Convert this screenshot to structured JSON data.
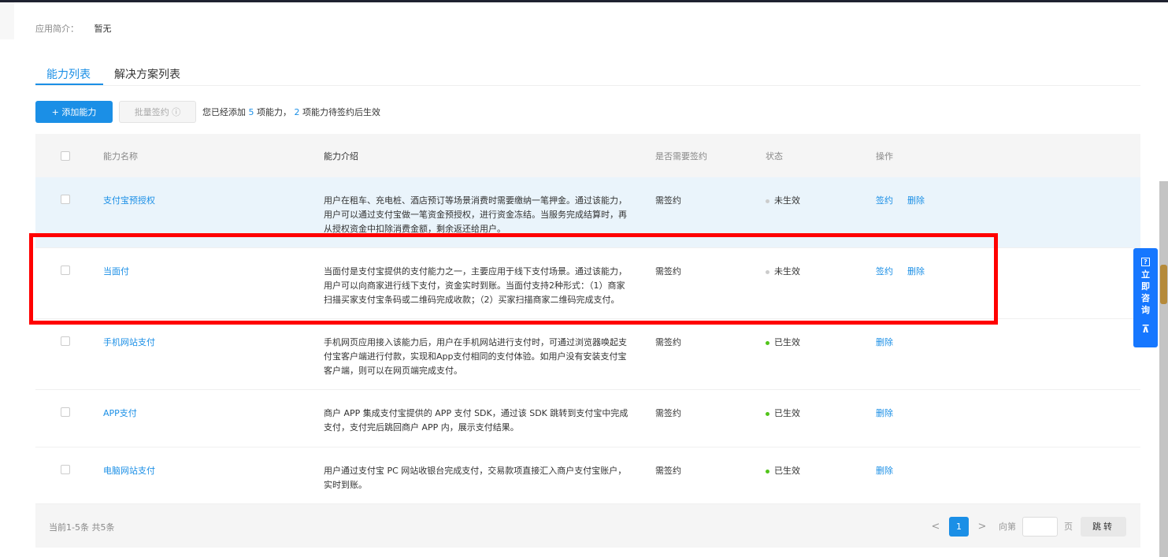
{
  "intro": {
    "label": "应用简介：",
    "value": "暂无"
  },
  "tabs": [
    {
      "label": "能力列表",
      "active": true
    },
    {
      "label": "解决方案列表",
      "active": false
    }
  ],
  "toolbar": {
    "add_label": "+  添加能力",
    "batch_label": "批量签约 ⓘ",
    "summary": {
      "p1": "您已经添加 ",
      "n1": "5",
      "p2": " 项能力， ",
      "n2": "2",
      "p3": " 项能力待签约后生效"
    }
  },
  "table": {
    "headers": {
      "name": "能力名称",
      "desc": "能力介绍",
      "sign": "是否需要签约",
      "status": "状态",
      "ops": "操作"
    },
    "rows": [
      {
        "name": "支付宝预授权",
        "desc": "用户在租车、充电桩、酒店预订等场景消费时需要缴纳一笔押金。通过该能力，用户可以通过支付宝做一笔资金预授权，进行资金冻结。当服务完成结算时，再从授权资金中扣除消费金额，剩余返还给用户。",
        "sign": "需签约",
        "status": "未生效",
        "status_color": "#cccccc",
        "ops": [
          "签约",
          "删除"
        ]
      },
      {
        "name": "当面付",
        "desc": "当面付是支付宝提供的支付能力之一，主要应用于线下支付场景。通过该能力，用户可以向商家进行线下支付，资金实时到账。当面付支持2种形式：（1）商家扫描买家支付宝条码或二维码完成收款；（2）买家扫描商家二维码完成支付。",
        "sign": "需签约",
        "status": "未生效",
        "status_color": "#cccccc",
        "ops": [
          "签约",
          "删除"
        ]
      },
      {
        "name": "手机网站支付",
        "desc": "手机网页应用接入该能力后，用户在手机网站进行支付时，可通过浏览器唤起支付宝客户端进行付款，实现和App支付相同的支付体验。如用户没有安装支付宝客户端，则可以在网页端完成支付。",
        "sign": "需签约",
        "status": "已生效",
        "status_color": "#52c41a",
        "ops": [
          "删除"
        ]
      },
      {
        "name": "APP支付",
        "desc": "商户 APP 集成支付宝提供的 APP 支付 SDK，通过该 SDK 跳转到支付宝中完成支付，支付完后跳回商户 APP 内，展示支付结果。",
        "sign": "需签约",
        "status": "已生效",
        "status_color": "#52c41a",
        "ops": [
          "删除"
        ]
      },
      {
        "name": "电脑网站支付",
        "desc": "用户通过支付宝 PC 网站收银台完成支付，交易款项直接汇入商户支付宝账户，实时到账。",
        "sign": "需签约",
        "status": "已生效",
        "status_color": "#52c41a",
        "ops": [
          "删除"
        ]
      }
    ]
  },
  "footer": {
    "total": "当前1-5条 共5条",
    "prev": "<",
    "current_page": "1",
    "next": ">",
    "goto_label": "向第",
    "page_unit": "页",
    "go_label": "跳转",
    "goto_value": ""
  },
  "float": {
    "icon": "question-icon",
    "label": [
      "立",
      "即",
      "咨",
      "询"
    ],
    "top_icon": "back-to-top-icon"
  },
  "colors": {
    "accent": "#1b8fe6",
    "highlight_box": "#ff0000",
    "float_bg": "#1677ff"
  }
}
